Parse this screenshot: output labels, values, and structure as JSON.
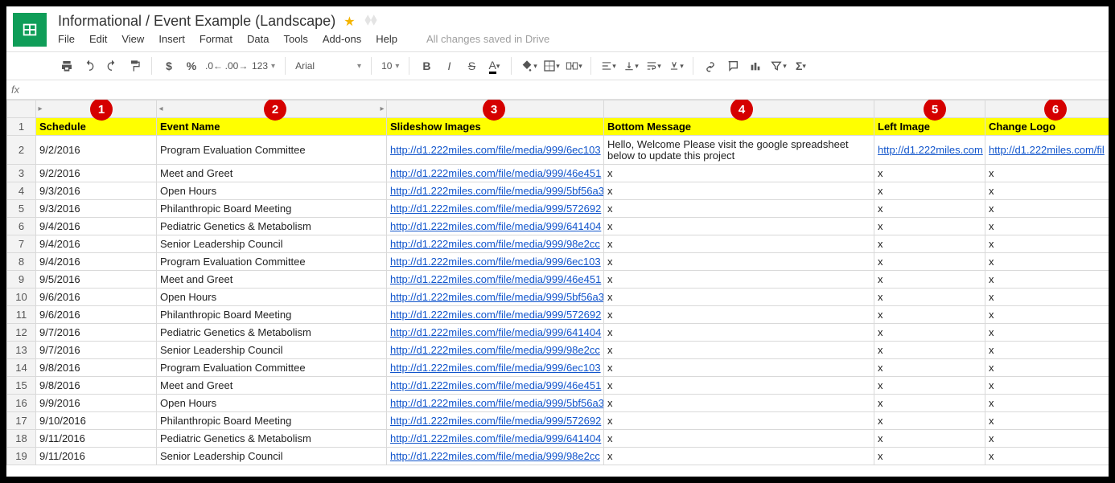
{
  "doc_title": "Informational / Event Example (Landscape)",
  "menu": {
    "file": "File",
    "edit": "Edit",
    "view": "View",
    "insert": "Insert",
    "format": "Format",
    "data": "Data",
    "tools": "Tools",
    "addons": "Add-ons",
    "help": "Help"
  },
  "save_status": "All changes saved in Drive",
  "toolbar": {
    "font": "Arial",
    "size": "10",
    "more": "123"
  },
  "fx_label": "fx",
  "markers": [
    "1",
    "2",
    "3",
    "4",
    "5",
    "6"
  ],
  "headers": {
    "schedule": "Schedule",
    "event": "Event Name",
    "slideshow": "Slideshow Images",
    "message": "Bottom Message",
    "left": "Left Image",
    "logo": "Change Logo"
  },
  "rows": [
    {
      "n": "2",
      "date": "9/2/2016",
      "event": "Program Evaluation Committee",
      "slide": "http://d1.222miles.com/file/media/999/6ec103",
      "msg": "Hello, Welcome    Please visit the google spreadsheet below to update this project",
      "left": "http://d1.222miles.com",
      "logo": "http://d1.222miles.com/fil",
      "msg_center": true,
      "left_link": true,
      "logo_link": true
    },
    {
      "n": "3",
      "date": "9/2/2016",
      "event": "Meet and Greet",
      "slide": "http://d1.222miles.com/file/media/999/46e451",
      "msg": "x",
      "left": "x",
      "logo": "x"
    },
    {
      "n": "4",
      "date": "9/3/2016",
      "event": "Open Hours",
      "slide": "http://d1.222miles.com/file/media/999/5bf56a3",
      "msg": "x",
      "left": "x",
      "logo": "x"
    },
    {
      "n": "5",
      "date": "9/3/2016",
      "event": "Philanthropic Board Meeting",
      "slide": "http://d1.222miles.com/file/media/999/572692",
      "msg": "x",
      "left": "x",
      "logo": "x"
    },
    {
      "n": "6",
      "date": "9/4/2016",
      "event": "Pediatric Genetics & Metabolism",
      "slide": "http://d1.222miles.com/file/media/999/641404",
      "msg": "x",
      "left": "x",
      "logo": "x"
    },
    {
      "n": "7",
      "date": "9/4/2016",
      "event": "Senior Leadership Council",
      "slide": "http://d1.222miles.com/file/media/999/98e2cc",
      "msg": "x",
      "left": "x",
      "logo": "x"
    },
    {
      "n": "8",
      "date": "9/4/2016",
      "event": "Program Evaluation Committee",
      "slide": "http://d1.222miles.com/file/media/999/6ec103",
      "msg": "x",
      "left": "x",
      "logo": "x"
    },
    {
      "n": "9",
      "date": "9/5/2016",
      "event": "Meet and Greet",
      "slide": "http://d1.222miles.com/file/media/999/46e451",
      "msg": "x",
      "left": "x",
      "logo": "x"
    },
    {
      "n": "10",
      "date": "9/6/2016",
      "event": "Open Hours",
      "slide": "http://d1.222miles.com/file/media/999/5bf56a3",
      "msg": "x",
      "left": "x",
      "logo": "x"
    },
    {
      "n": "11",
      "date": "9/6/2016",
      "event": "Philanthropic Board Meeting",
      "slide": "http://d1.222miles.com/file/media/999/572692",
      "msg": "x",
      "left": "x",
      "logo": "x"
    },
    {
      "n": "12",
      "date": "9/7/2016",
      "event": "Pediatric Genetics & Metabolism",
      "slide": "http://d1.222miles.com/file/media/999/641404",
      "msg": "x",
      "left": "x",
      "logo": "x"
    },
    {
      "n": "13",
      "date": "9/7/2016",
      "event": "Senior Leadership Council",
      "slide": "http://d1.222miles.com/file/media/999/98e2cc",
      "msg": "x",
      "left": "x",
      "logo": "x"
    },
    {
      "n": "14",
      "date": "9/8/2016",
      "event": "Program Evaluation Committee",
      "slide": "http://d1.222miles.com/file/media/999/6ec103",
      "msg": "x",
      "left": "x",
      "logo": "x"
    },
    {
      "n": "15",
      "date": "9/8/2016",
      "event": "Meet and Greet",
      "slide": "http://d1.222miles.com/file/media/999/46e451",
      "msg": "x",
      "left": "x",
      "logo": "x"
    },
    {
      "n": "16",
      "date": "9/9/2016",
      "event": "Open Hours",
      "slide": "http://d1.222miles.com/file/media/999/5bf56a3",
      "msg": "x",
      "left": "x",
      "logo": "x"
    },
    {
      "n": "17",
      "date": "9/10/2016",
      "event": "Philanthropic Board Meeting",
      "slide": "http://d1.222miles.com/file/media/999/572692",
      "msg": "x",
      "left": "x",
      "logo": "x"
    },
    {
      "n": "18",
      "date": "9/11/2016",
      "event": "Pediatric Genetics & Metabolism",
      "slide": "http://d1.222miles.com/file/media/999/641404",
      "msg": "x",
      "left": "x",
      "logo": "x"
    },
    {
      "n": "19",
      "date": "9/11/2016",
      "event": "Senior Leadership Council",
      "slide": "http://d1.222miles.com/file/media/999/98e2cc",
      "msg": "x",
      "left": "x",
      "logo": "x"
    }
  ]
}
